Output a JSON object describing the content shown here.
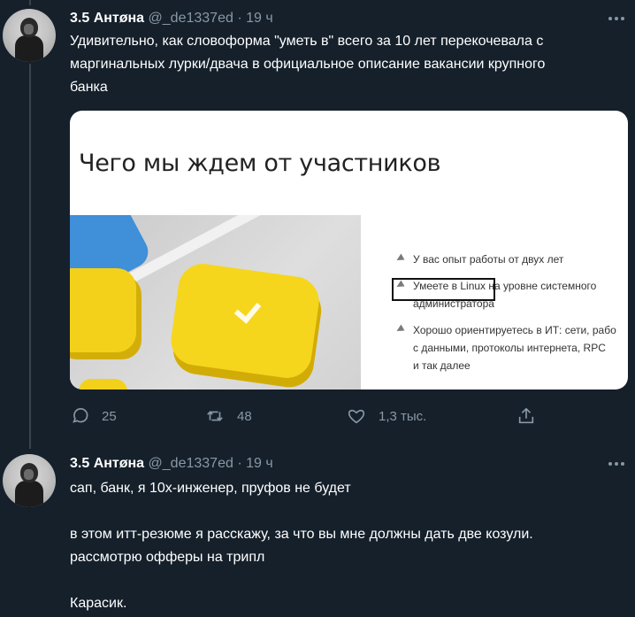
{
  "tweets": [
    {
      "author": {
        "name": "3.5 Антøна",
        "handle": "@_de1337ed",
        "dot": "·",
        "time": "19 ч"
      },
      "text_lines": [
        "Удивительно, как словоформа \"уметь в\" всего за 10 лет перекочевала с",
        "маргинальных лурки/двача в официальное описание вакансии крупного",
        "банка"
      ],
      "media": {
        "title": "Чего мы ждем от участников",
        "bullets": [
          [
            "У вас опыт работы от двух лет"
          ],
          [
            "Умеете в Linux на уровне системного",
            "администратора"
          ],
          [
            "Хорошо ориентируетесь в ИТ: сети, рабо",
            "с данными, протоколы интернета, RPC",
            "и так далее"
          ]
        ]
      },
      "actions": {
        "reply_count": "25",
        "retweet_count": "48",
        "like_count": "1,3 тыс."
      }
    },
    {
      "author": {
        "name": "3.5 Антøна",
        "handle": "@_de1337ed",
        "dot": "·",
        "time": "19 ч"
      },
      "paragraphs": [
        "сап, банк, я 10х-инженер, пруфов не будет",
        "в этом итт-резюме я расскажу, за что вы мне должны дать две козули.",
        "рассмотрю офферы на трипл",
        "Карасик."
      ]
    }
  ],
  "colors": {
    "background": "#15202b",
    "secondary_text": "#8899a6",
    "thread_line": "#38444d"
  },
  "icons": [
    "reply-icon",
    "retweet-icon",
    "like-icon",
    "share-icon",
    "more-icon"
  ]
}
